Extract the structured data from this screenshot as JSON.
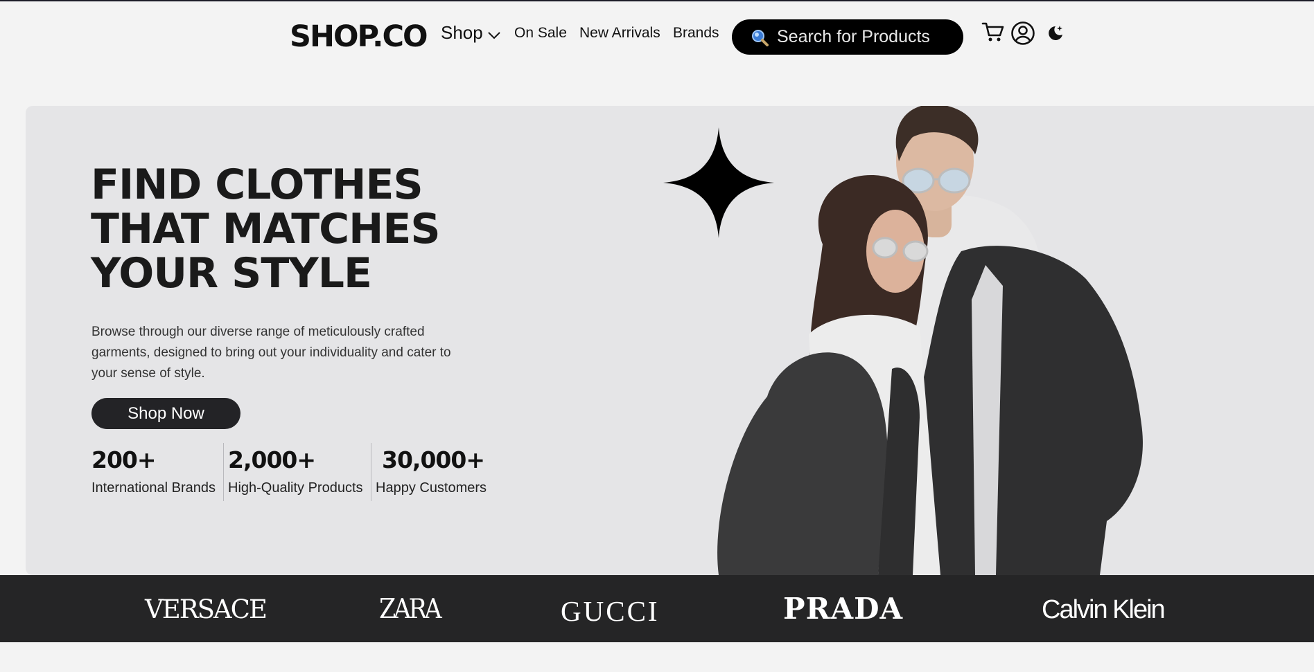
{
  "header": {
    "logo": "SHOP.CO",
    "nav": {
      "shop": "Shop",
      "on_sale": "On Sale",
      "new_arrivals": "New Arrivals",
      "brands": "Brands"
    },
    "search": {
      "placeholder": "Search for Products",
      "value": ""
    },
    "icons": [
      "cart-icon",
      "user-icon",
      "moon-icon",
      "search-icon",
      "chevron-down-icon"
    ]
  },
  "hero": {
    "headline": [
      "FIND CLOTHES",
      "THAT MATCHES",
      "YOUR STYLE"
    ],
    "description": "Browse through our diverse range of meticulously crafted garments, designed to bring out your individuality and cater to your sense of style.",
    "cta": "Shop Now",
    "stats": [
      {
        "value": "200+",
        "label": "International Brands"
      },
      {
        "value": "2,000+",
        "label": "High-Quality Products"
      },
      {
        "value": "30,000+",
        "label": "Happy Customers"
      }
    ]
  },
  "brands": [
    "VERSACE",
    "ZARA",
    "GUCCI",
    "PRADA",
    "Calvin Klein"
  ],
  "colors": {
    "page_bg": "#f3f3f3",
    "hero_bg": "#e5e5e7",
    "primary": "#000000",
    "brand_bar": "#252526"
  }
}
